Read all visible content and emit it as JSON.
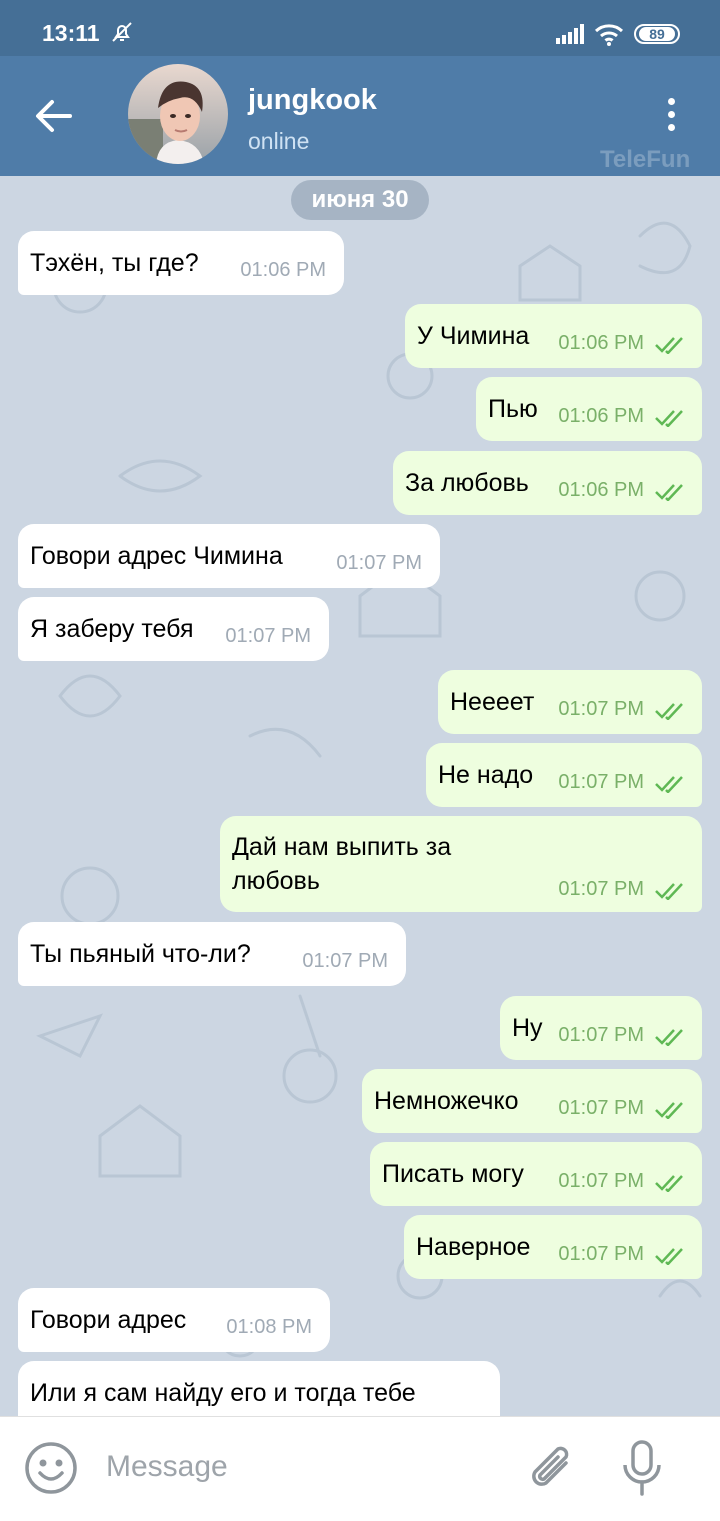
{
  "status_bar": {
    "time": "13:11",
    "battery": "89"
  },
  "header": {
    "name": "jungkook",
    "status": "online",
    "watermark": "TeleFun"
  },
  "chat": {
    "date": "июня 30",
    "messages": [
      {
        "dir": "in",
        "text": "Тэхён, ты где?",
        "time": "01:06 PM"
      },
      {
        "dir": "out",
        "text": "У Чимина",
        "time": "01:06 PM"
      },
      {
        "dir": "out",
        "text": "Пью",
        "time": "01:06 PM"
      },
      {
        "dir": "out",
        "text": "За любовь",
        "time": "01:06 PM"
      },
      {
        "dir": "in",
        "text": "Говори адрес Чимина",
        "time": "01:07 PM"
      },
      {
        "dir": "in",
        "text": "Я заберу тебя",
        "time": "01:07 PM"
      },
      {
        "dir": "out",
        "text": "Неееет",
        "time": "01:07 PM"
      },
      {
        "dir": "out",
        "text": "Не надо",
        "time": "01:07 PM"
      },
      {
        "dir": "out",
        "text": "Дай нам выпить за любовь",
        "time": "01:07 PM"
      },
      {
        "dir": "in",
        "text": "Ты пьяный что-ли?",
        "time": "01:07 PM"
      },
      {
        "dir": "out",
        "text": "Ну",
        "time": "01:07 PM"
      },
      {
        "dir": "out",
        "text": "Немножечко",
        "time": "01:07 PM"
      },
      {
        "dir": "out",
        "text": "Писать могу",
        "time": "01:07 PM"
      },
      {
        "dir": "out",
        "text": "Наверное",
        "time": "01:07 PM"
      },
      {
        "dir": "in",
        "text": "Говори адрес",
        "time": "01:08 PM"
      },
      {
        "dir": "in",
        "text": "Или я сам найду его и тогда тебе",
        "time": ""
      }
    ]
  },
  "input": {
    "placeholder": "Message"
  },
  "colors": {
    "header": "#4f7ca8",
    "statusbar": "#456f96",
    "outgoing_bubble": "#eefedf",
    "incoming_bubble": "#ffffff",
    "check": "#5fb854"
  },
  "icons": [
    "back-arrow-icon",
    "more-vert-icon",
    "emoji-icon",
    "attach-icon",
    "mic-icon",
    "double-check-icon",
    "bell-off-icon",
    "signal-icon",
    "wifi-icon",
    "battery-icon"
  ]
}
